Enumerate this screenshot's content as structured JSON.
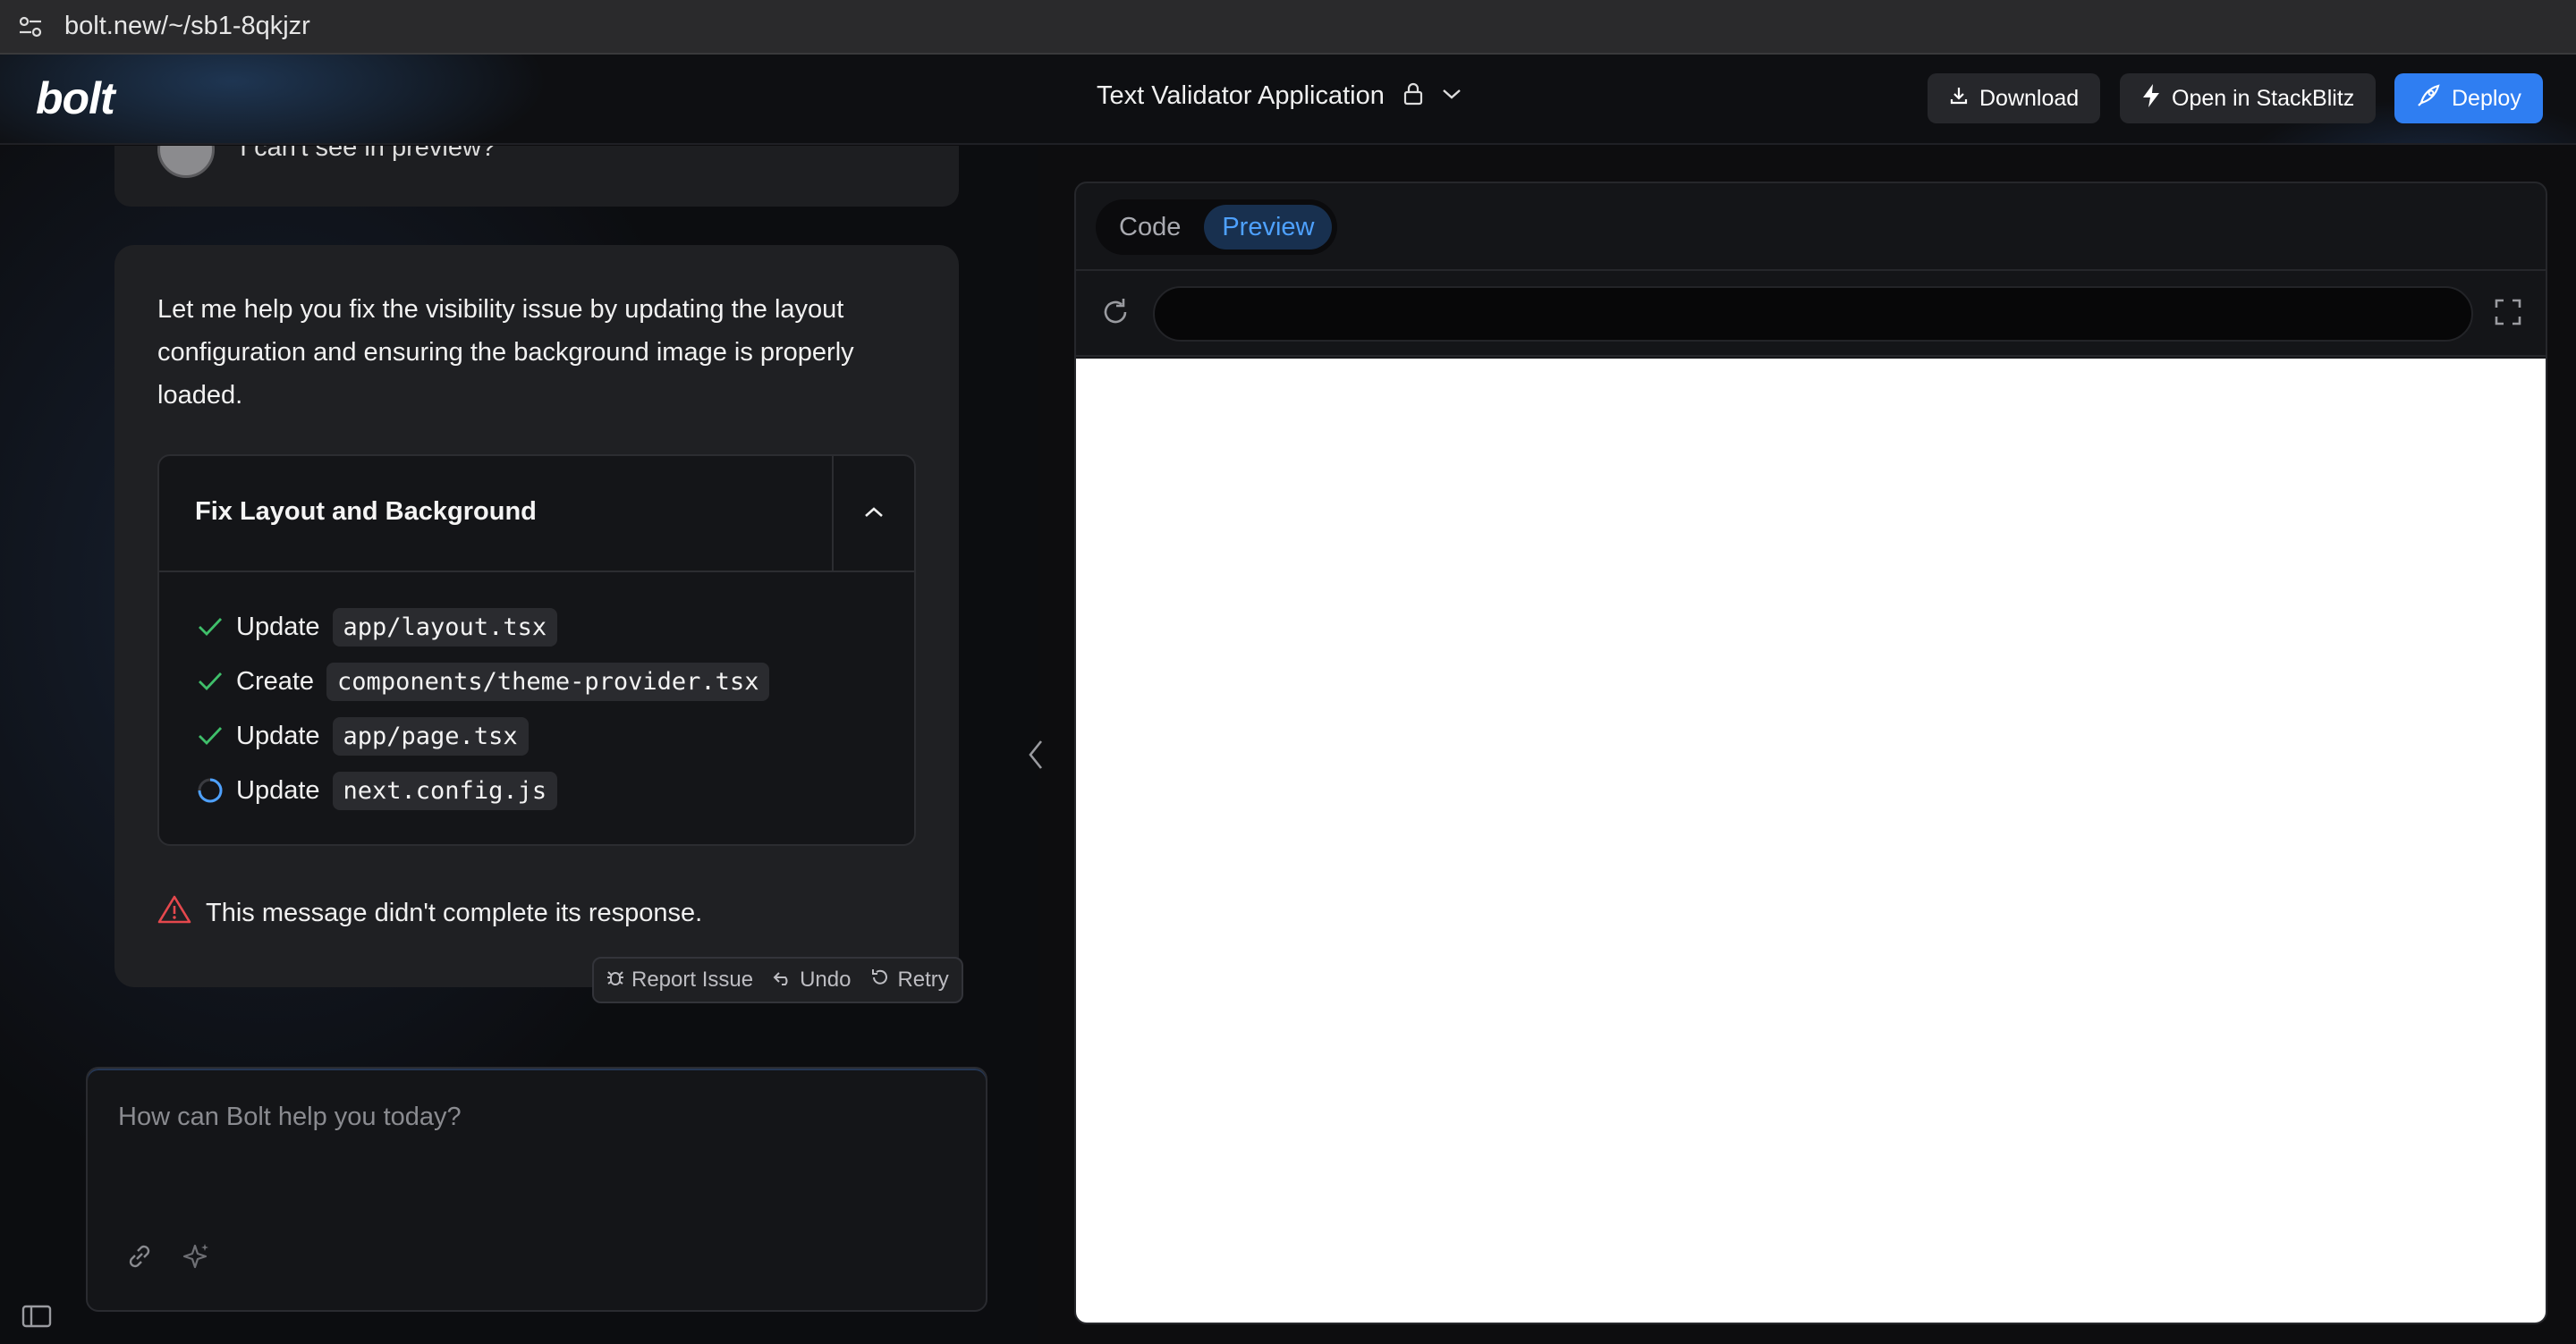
{
  "browser": {
    "url": "bolt.new/~/sb1-8qkjzr"
  },
  "header": {
    "logo": "bolt",
    "project_title": "Text Validator Application",
    "download_label": "Download",
    "stackblitz_label": "Open in StackBlitz",
    "deploy_label": "Deploy"
  },
  "chat": {
    "previous_user_message": "I can't see in preview?",
    "assistant_message": "Let me help you fix the visibility issue by updating the layout configuration and ensuring the background image is properly loaded.",
    "artifact": {
      "title": "Fix Layout and Background",
      "steps": [
        {
          "action": "Update",
          "file": "app/layout.tsx",
          "status": "done"
        },
        {
          "action": "Create",
          "file": "components/theme-provider.tsx",
          "status": "done"
        },
        {
          "action": "Update",
          "file": "app/page.tsx",
          "status": "done"
        },
        {
          "action": "Update",
          "file": "next.config.js",
          "status": "in-progress"
        }
      ]
    },
    "warning": "This message didn't complete its response.",
    "actions": {
      "report": "Report Issue",
      "undo": "Undo",
      "retry": "Retry"
    },
    "prompt_placeholder": "How can Bolt help you today?"
  },
  "workbench": {
    "tabs": [
      {
        "label": "Code",
        "active": false
      },
      {
        "label": "Preview",
        "active": true
      }
    ],
    "address_value": ""
  },
  "colors": {
    "accent": "#2f7ef2",
    "success": "#3fbf6a",
    "warning": "#e5484d",
    "active_tab_text": "#4ea1ff"
  }
}
